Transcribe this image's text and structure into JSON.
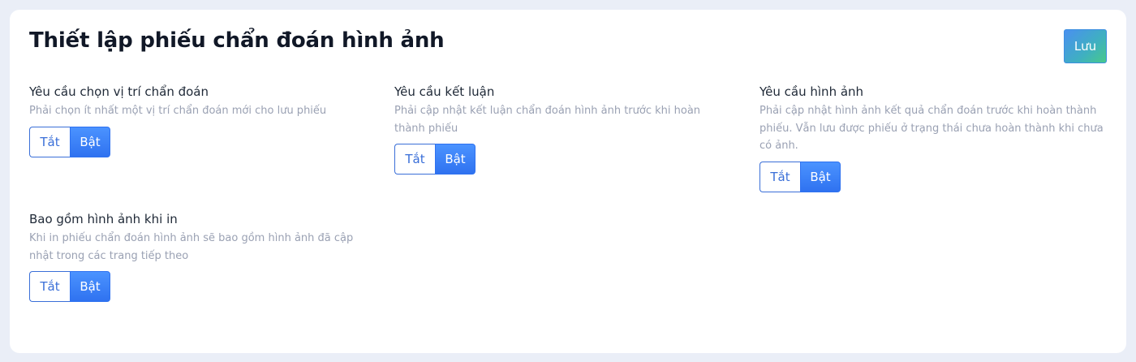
{
  "header": {
    "title": "Thiết lập phiếu chẩn đoán hình ảnh",
    "save_label": "Lưu"
  },
  "settings": [
    {
      "title": "Yêu cầu chọn vị trí chẩn đoán",
      "description": "Phải chọn ít nhất một vị trí chẩn đoán mới cho lưu phiếu",
      "off_label": "Tắt",
      "on_label": "Bật",
      "selected": "Bật"
    },
    {
      "title": "Yêu cầu kết luận",
      "description": "Phải cập nhật kết luận chẩn đoán hình ảnh trước khi hoàn thành phiếu",
      "off_label": "Tắt",
      "on_label": "Bật",
      "selected": "Bật"
    },
    {
      "title": "Yêu cầu hình ảnh",
      "description": "Phải cập nhật hình ảnh kết quả chẩn đoán trước khi hoàn thành phiếu. Vẫn lưu được phiếu ở trạng thái chưa hoàn thành khi chưa có ảnh.",
      "off_label": "Tắt",
      "on_label": "Bật",
      "selected": "Bật"
    },
    {
      "title": "Bao gồm hình ảnh khi in",
      "description": "Khi in phiếu chẩn đoán hình ảnh sẽ bao gồm hình ảnh đã cập nhật trong các trang tiếp theo",
      "off_label": "Tắt",
      "on_label": "Bật",
      "selected": "Bật"
    }
  ],
  "colors": {
    "accent": "#2f72f0",
    "background": "#eaeef7",
    "card": "#ffffff"
  }
}
